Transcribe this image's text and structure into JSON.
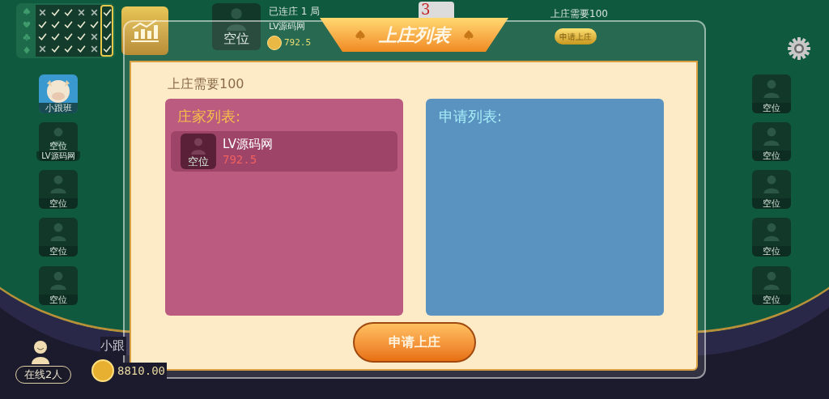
{
  "history": {
    "columns": [
      {
        "selected": false,
        "results": [
          false,
          true,
          true,
          false
        ]
      },
      {
        "selected": false,
        "results": [
          true,
          true,
          true,
          true
        ]
      },
      {
        "selected": false,
        "results": [
          true,
          true,
          true,
          true
        ]
      },
      {
        "selected": false,
        "results": [
          false,
          true,
          true,
          true
        ]
      },
      {
        "selected": false,
        "results": [
          false,
          true,
          false,
          false
        ]
      },
      {
        "selected": true,
        "results": [
          true,
          true,
          true,
          true
        ]
      }
    ]
  },
  "banker": {
    "seat_label": "空位",
    "streak": "已连庄 1 局",
    "name": "LV源码网",
    "coins": "792.5"
  },
  "card": "3",
  "requirement": "上庄需要100",
  "left_seats": [
    {
      "kind": "player",
      "label": "小跟班"
    },
    {
      "kind": "empty",
      "label": "空位",
      "name": "LV源码网"
    },
    {
      "kind": "empty",
      "label": "空位"
    },
    {
      "kind": "empty",
      "label": "空位"
    },
    {
      "kind": "empty",
      "label": "空位"
    }
  ],
  "right_seats": [
    {
      "kind": "empty",
      "label": "空位"
    },
    {
      "kind": "empty",
      "label": "空位"
    },
    {
      "kind": "empty",
      "label": "空位"
    },
    {
      "kind": "empty",
      "label": "空位"
    },
    {
      "kind": "empty",
      "label": "空位"
    }
  ],
  "player": {
    "online": "在线2人",
    "name": "小跟",
    "coins": "8810.00"
  },
  "dialog": {
    "title": "上庄列表",
    "header_button": "申请上庄",
    "requirement": "上庄需要100",
    "banker_list": {
      "title": "庄家列表:",
      "rows": [
        {
          "seat_label": "空位",
          "name": "LV源码网",
          "coins": "792.5"
        }
      ]
    },
    "apply_list": {
      "title": "申请列表:"
    },
    "button": "申请上庄"
  }
}
